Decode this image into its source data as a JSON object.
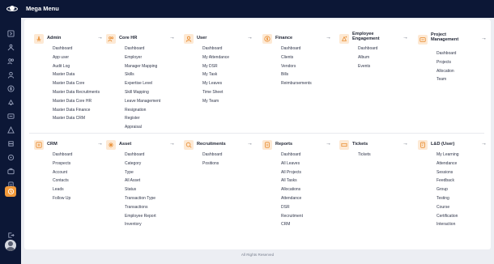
{
  "app": {
    "title": "Mega Menu"
  },
  "menu": [
    {
      "title": "Admin",
      "icon": "admin-icon",
      "items": [
        "Dashboard",
        "App user",
        "Audit Log",
        "Master Data",
        "Master Data Core",
        "Master Data Recruitments",
        "Master Data Core HR",
        "Master Data Finance",
        "Master Data CRM"
      ]
    },
    {
      "title": "Core HR",
      "icon": "users-group-icon",
      "items": [
        "Dashboard",
        "Employer",
        "Manager Mapping",
        "Skills",
        "Expertise Level",
        "Skill Mapping",
        "Leave Management",
        "Resignation",
        "Register",
        "Appraisal"
      ]
    },
    {
      "title": "User",
      "icon": "user-icon",
      "items": [
        "Dashboard",
        "My Attendance",
        "My DSR",
        "My Task",
        "My Leaves",
        "Time Sheet",
        "My Team"
      ]
    },
    {
      "title": "Finance",
      "icon": "dollar-icon",
      "items": [
        "Dashboard",
        "Clients",
        "Vendors",
        "Bills",
        "Reimbursements"
      ]
    },
    {
      "title": "Employee Engagement",
      "icon": "engagement-icon",
      "items": [
        "Dashboard",
        "Album",
        "Events"
      ]
    },
    {
      "title": "Project Management",
      "icon": "project-icon",
      "items": [
        "Dashboard",
        "Projects",
        "Allocation",
        "Team"
      ]
    },
    {
      "title": "CRM",
      "icon": "crm-icon",
      "items": [
        "Dashboard",
        "Prospects",
        "Account",
        "Contacts",
        "Leads",
        "Follow Up"
      ]
    },
    {
      "title": "Asset",
      "icon": "asset-icon",
      "items": [
        "Dashboard",
        "Category",
        "Type",
        "All Asset",
        "Status",
        "Transaction Type",
        "Transactions",
        "Employee Report",
        "Inventory"
      ]
    },
    {
      "title": "Recruitments",
      "icon": "recruitment-icon",
      "items": [
        "Dashboard",
        "Positions"
      ]
    },
    {
      "title": "Reports",
      "icon": "report-icon",
      "items": [
        "Dashboard",
        "All Leaves",
        "All Projects",
        "All Tasks",
        "Allocations",
        "Attendance",
        "DSR",
        "Recruitment",
        "CRM"
      ]
    },
    {
      "title": "Tickets",
      "icon": "ticket-icon",
      "items": [
        "Tickets"
      ]
    },
    {
      "title": "L&D (User)",
      "icon": "learning-icon",
      "items": [
        "My Learning",
        "Attendance",
        "Sessions",
        "Feedback",
        "Group",
        "Testing",
        "Course",
        "Certification",
        "Interaction"
      ]
    }
  ],
  "footer": {
    "text": "All Rights Reserved"
  },
  "colors": {
    "sidebar": "#0c1736",
    "accent": "#f39a3a",
    "icon_bg": "#fde9d4"
  }
}
